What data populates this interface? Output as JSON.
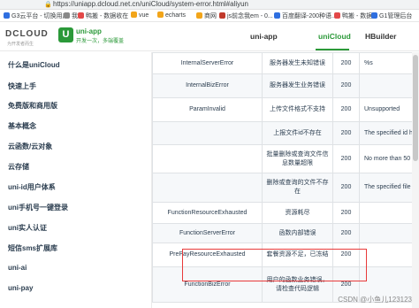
{
  "browser": {
    "url": "https://uniapp.dcloud.net.cn/uniCloud/system-error.html#aliyun",
    "bookmarks": [
      {
        "label": "G3云平台 - 切换用户",
        "color": "#2f6fe0"
      },
      {
        "label": "我",
        "color": "#888888"
      },
      {
        "label": "鸭搬 - 数据收在",
        "color": "#e34848"
      },
      {
        "label": "vue",
        "color": "#f2a51a"
      },
      {
        "label": "echarts",
        "color": "#f2a51a"
      },
      {
        "label": "商网",
        "color": "#f2a51a"
      },
      {
        "label": "js前念我em - 0...",
        "color": "#c0392b"
      },
      {
        "label": "百度翻译-200种语...",
        "color": "#2f6fe0"
      },
      {
        "label": "鸭搬 - 数据...",
        "color": "#e34848"
      },
      {
        "label": "G1管理后台",
        "color": "#2f6fe0"
      }
    ]
  },
  "header": {
    "logo": "DCLOUD",
    "logo_sub": "为开发者而生",
    "app_icon": "U",
    "app_name": "uni-app",
    "app_slogan": "开发一次，多端覆盖",
    "nav": [
      {
        "label": "uni-app",
        "active": false
      },
      {
        "label": "uniCloud",
        "active": true
      },
      {
        "label": "HBuilder",
        "active": false
      }
    ]
  },
  "sidebar": {
    "items": [
      "什么是uniCloud",
      "快速上手",
      "免费版和商用版",
      "基本概念",
      "云函数/云对象",
      "云存储",
      "uni-id用户体系",
      "uni手机号一键登录",
      "uni实人认证",
      "短信sms扩展库",
      "uni-ai",
      "uni-pay"
    ]
  },
  "table": {
    "rows": [
      {
        "name": "InternalServerError",
        "desc": "服务器发生未知错误",
        "code": "200",
        "extra": "%s"
      },
      {
        "name": "InternalBizError",
        "desc": "服务器发生业务错误",
        "code": "200",
        "extra": ""
      },
      {
        "name": "ParamInvalid",
        "desc": "上传文件格式不支持",
        "code": "200",
        "extra": "Unsupported"
      },
      {
        "name": "",
        "desc": "上报文件id不存在",
        "code": "200",
        "extra": "The specified id has expi"
      },
      {
        "name": "",
        "desc": "批量删除或查询文件信息数量超限",
        "code": "200",
        "extra": "No more than 50"
      },
      {
        "name": "",
        "desc": "删除或查询的文件不存在",
        "code": "200",
        "extra": "The specified file"
      },
      {
        "name": "FunctionResourceExhausted",
        "desc": "资源耗尽",
        "code": "200",
        "extra": ""
      },
      {
        "name": "FunctionServerError",
        "desc": "函数内部错误",
        "code": "200",
        "extra": ""
      },
      {
        "name": "PrePayResourceExhausted",
        "desc": "套餐资源不足，已冻结",
        "code": "200",
        "extra": ""
      },
      {
        "name": "FunctionBizError",
        "desc": "用户的函数业务错误，请检查代码逻辑",
        "code": "200",
        "extra": ""
      }
    ]
  },
  "watermark": "CSDN @小鱼儿123123",
  "colors": {
    "accent": "#2b9939",
    "highlight": "#e83a3a"
  }
}
